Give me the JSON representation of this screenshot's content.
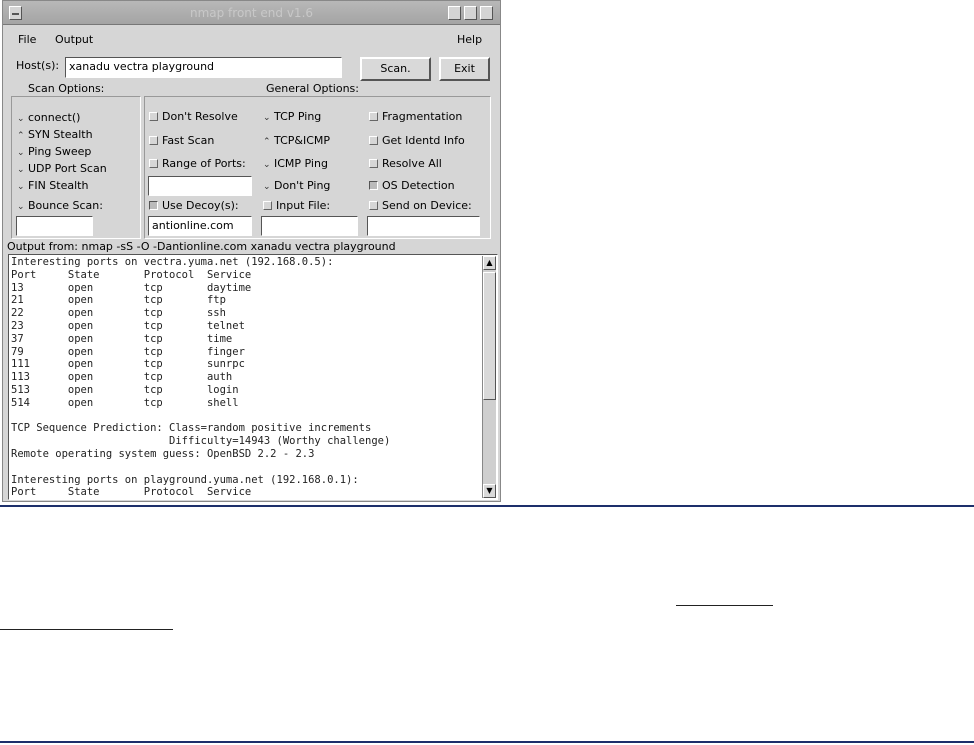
{
  "window": {
    "title": "nmap front end v1.6"
  },
  "menu": {
    "file": "File",
    "output": "Output",
    "help": "Help"
  },
  "host": {
    "label": "Host(s):",
    "value": "xanadu vectra playground"
  },
  "buttons": {
    "scan": "Scan.",
    "exit": "Exit"
  },
  "scan_options": {
    "title": "Scan Options:",
    "items": [
      "connect()",
      "SYN Stealth",
      "Ping Sweep",
      "UDP Port Scan",
      "FIN Stealth"
    ],
    "bounce": "Bounce Scan:"
  },
  "general_options": {
    "title": "General Options:",
    "col1": [
      "Don't Resolve",
      "Fast Scan",
      "Range of Ports:"
    ],
    "col2": [
      "TCP Ping",
      "TCP&ICMP",
      "ICMP Ping",
      "Don't Ping"
    ],
    "col3": [
      "Fragmentation",
      "Get Identd Info",
      "Resolve All",
      "OS Detection"
    ],
    "use_decoys": "Use Decoy(s):",
    "decoy_value": "antionline.com",
    "input_file": "Input File:",
    "send_on_device": "Send on Device:"
  },
  "output_from": "Output from:  nmap -sS -O -Dantionline.com xanadu vectra playground",
  "output_lines": [
    "Interesting ports on vectra.yuma.net (192.168.0.5):",
    "Port     State       Protocol  Service",
    "13       open        tcp       daytime",
    "21       open        tcp       ftp",
    "22       open        tcp       ssh",
    "23       open        tcp       telnet",
    "37       open        tcp       time",
    "79       open        tcp       finger",
    "111      open        tcp       sunrpc",
    "113      open        tcp       auth",
    "513      open        tcp       login",
    "514      open        tcp       shell",
    "",
    "TCP Sequence Prediction: Class=random positive increments",
    "                         Difficulty=14943 (Worthy challenge)",
    "Remote operating system guess: OpenBSD 2.2 - 2.3",
    "",
    "Interesting ports on playground.yuma.net (192.168.0.1):",
    "Port     State       Protocol  Service"
  ]
}
